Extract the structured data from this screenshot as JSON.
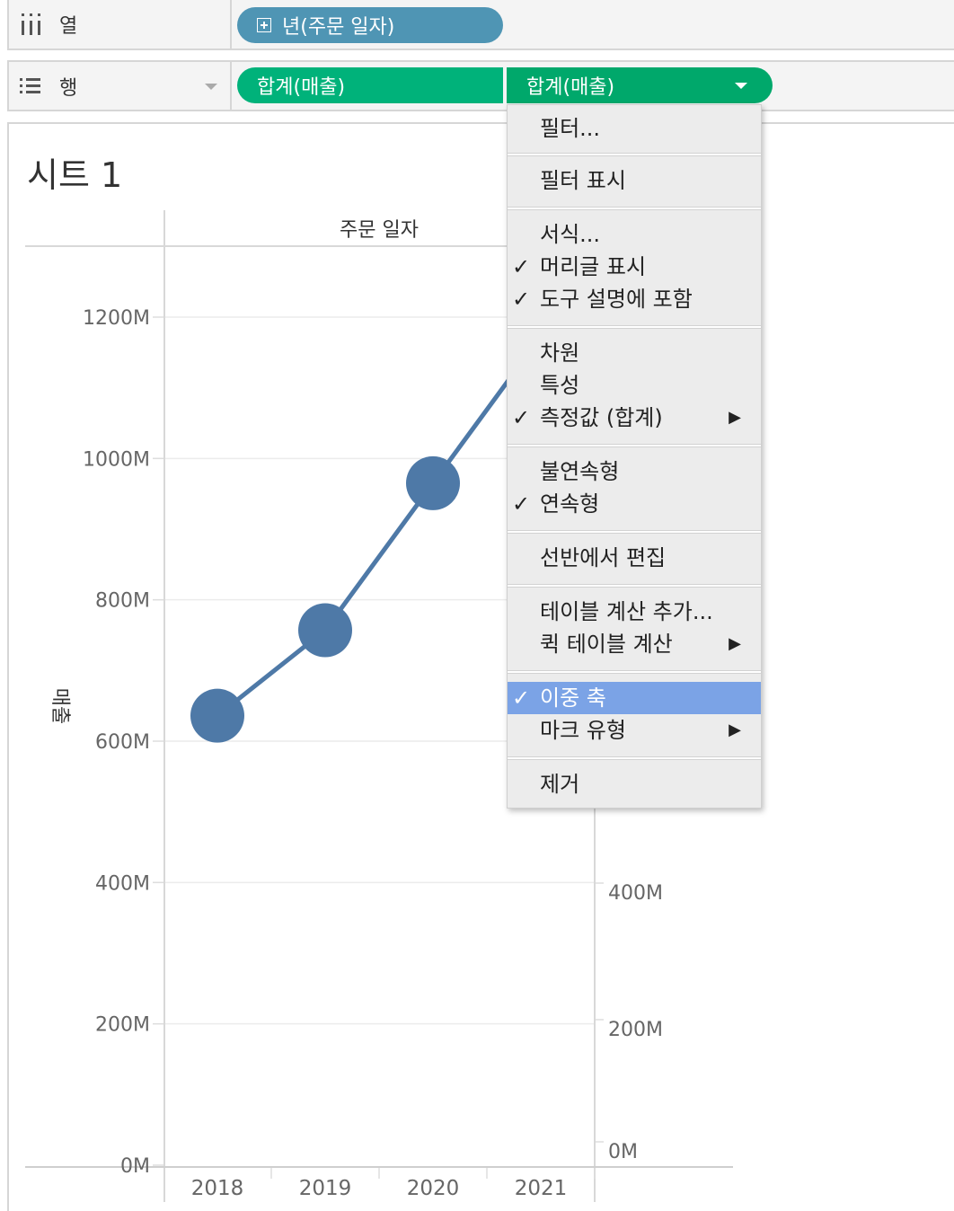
{
  "shelves": {
    "columns": {
      "label": "열",
      "pill": "년(주문 일자)"
    },
    "rows": {
      "label": "행",
      "pill1": "합계(매출)",
      "pill2": "합계(매출)"
    }
  },
  "sheet": {
    "title": "시트 1"
  },
  "colors": {
    "line": "#4e79a7",
    "menu_highlight": "#7ba3e6",
    "pill_blue": "#4f95b4",
    "pill_green": "#00b27a"
  },
  "chart_data": {
    "type": "line",
    "header": "주문 일자",
    "ylabel": "매출",
    "categories": [
      "2018",
      "2019",
      "2020",
      "2021"
    ],
    "series": [
      {
        "name": "합계(매출)",
        "values": [
          636,
          757,
          965,
          null
        ]
      }
    ],
    "ylim": [
      0,
      1300
    ],
    "y_ticks": [
      "0M",
      "200M",
      "400M",
      "600M",
      "800M",
      "1000M",
      "1200M"
    ],
    "y2_ticks": [
      "0M",
      "200M",
      "400M"
    ],
    "grid": true
  },
  "menu": {
    "items": [
      {
        "label": "필터...",
        "checked": false,
        "submenu": false
      },
      {
        "label": "필터 표시",
        "checked": false,
        "submenu": false
      },
      {
        "label": "서식...",
        "checked": false,
        "submenu": false
      },
      {
        "label": "머리글 표시",
        "checked": true,
        "submenu": false
      },
      {
        "label": "도구 설명에 포함",
        "checked": true,
        "submenu": false
      },
      {
        "label": "차원",
        "checked": false,
        "submenu": false
      },
      {
        "label": "특성",
        "checked": false,
        "submenu": false
      },
      {
        "label": "측정값 (합계)",
        "checked": true,
        "submenu": true
      },
      {
        "label": "불연속형",
        "checked": false,
        "submenu": false
      },
      {
        "label": "연속형",
        "checked": true,
        "submenu": false
      },
      {
        "label": "선반에서 편집",
        "checked": false,
        "submenu": false
      },
      {
        "label": "테이블 계산 추가...",
        "checked": false,
        "submenu": false
      },
      {
        "label": "퀵 테이블 계산",
        "checked": false,
        "submenu": true
      },
      {
        "label": "이중 축",
        "checked": true,
        "submenu": false,
        "highlighted": true
      },
      {
        "label": "마크 유형",
        "checked": false,
        "submenu": true
      },
      {
        "label": "제거",
        "checked": false,
        "submenu": false
      }
    ],
    "check_glyph": "✓",
    "arrow_glyph": "▶"
  }
}
